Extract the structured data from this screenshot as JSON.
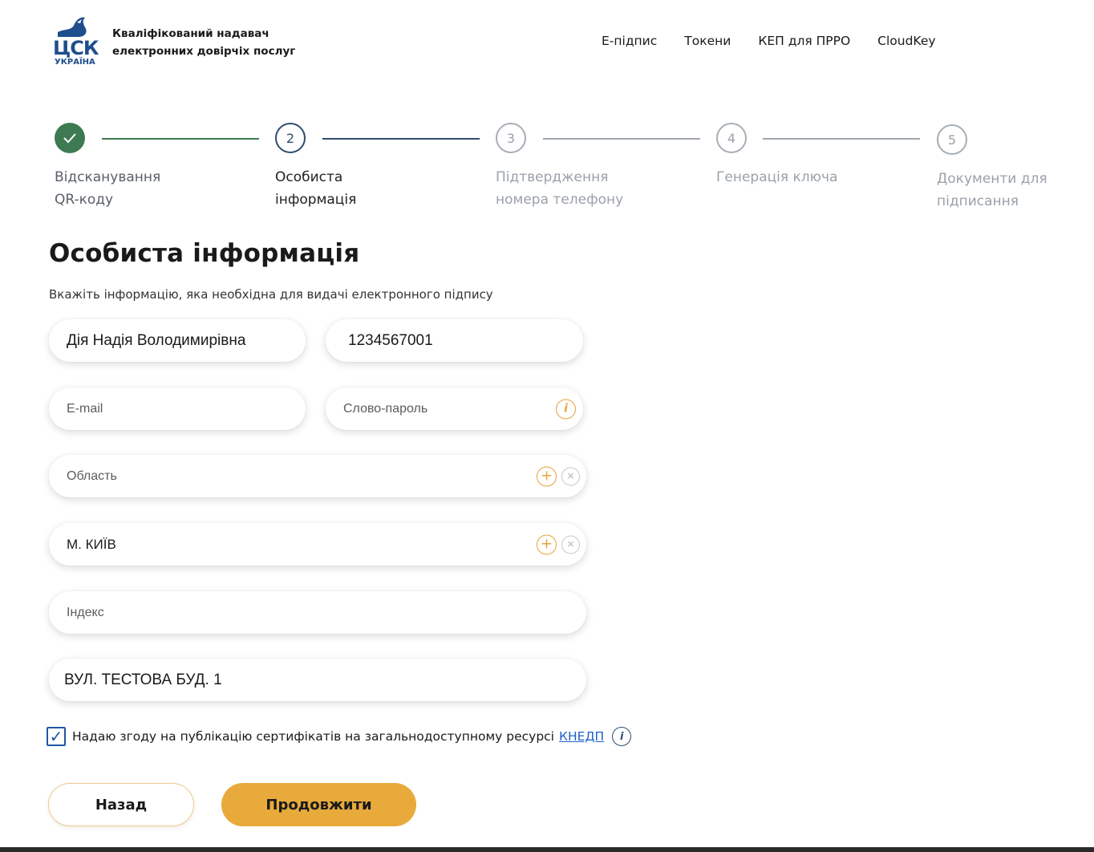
{
  "logo": {
    "text_main": "ЦСК",
    "text_sub": "УКРАЇНА"
  },
  "header": {
    "org_line1": "Кваліфікований надавач",
    "org_line2": "електронних довірчіх послуг",
    "nav": [
      "Е-підпис",
      "Токени",
      "КЕП для ПРРО",
      "CloudKey"
    ]
  },
  "stepper": {
    "steps": [
      {
        "number": "1",
        "state": "done",
        "line1": "Відсканування",
        "line2": "QR-коду"
      },
      {
        "number": "2",
        "state": "active",
        "line1": "Особиста",
        "line2": "інформація"
      },
      {
        "number": "3",
        "state": "todo",
        "line1": "Підтвердження",
        "line2": "номера телефону"
      },
      {
        "number": "4",
        "state": "todo",
        "line1": "Генерація ключа",
        "line2": ""
      },
      {
        "number": "5",
        "state": "todo",
        "line1": "Документи для",
        "line2": "підписання"
      }
    ]
  },
  "page": {
    "title": "Особиста інформація",
    "subtitle": "Вкажіть інформацію, яка необхідна для видачі електронного підпису"
  },
  "form": {
    "full_name": "Дія Надія Володимирівна",
    "tax_id": "1234567001",
    "email_placeholder": "E-mail",
    "password_placeholder": "Слово-пароль",
    "region_placeholder": "Область",
    "city": "М. КИЇВ",
    "index_placeholder": "Індекс",
    "address": "ВУЛ. ТЕСТОВА БУД. 1"
  },
  "consent": {
    "checked": true,
    "text": "Надаю згоду на публікацію сертифікатів на загальнодоступному ресурсі",
    "link": "КНЕДП"
  },
  "buttons": {
    "back": "Назад",
    "next": "Продовжити"
  },
  "colors": {
    "accent": "#e7aa3b",
    "done": "#3d7a52",
    "active": "#2f4d6e",
    "todo": "#a7aeb6",
    "link": "#1f63c8"
  }
}
